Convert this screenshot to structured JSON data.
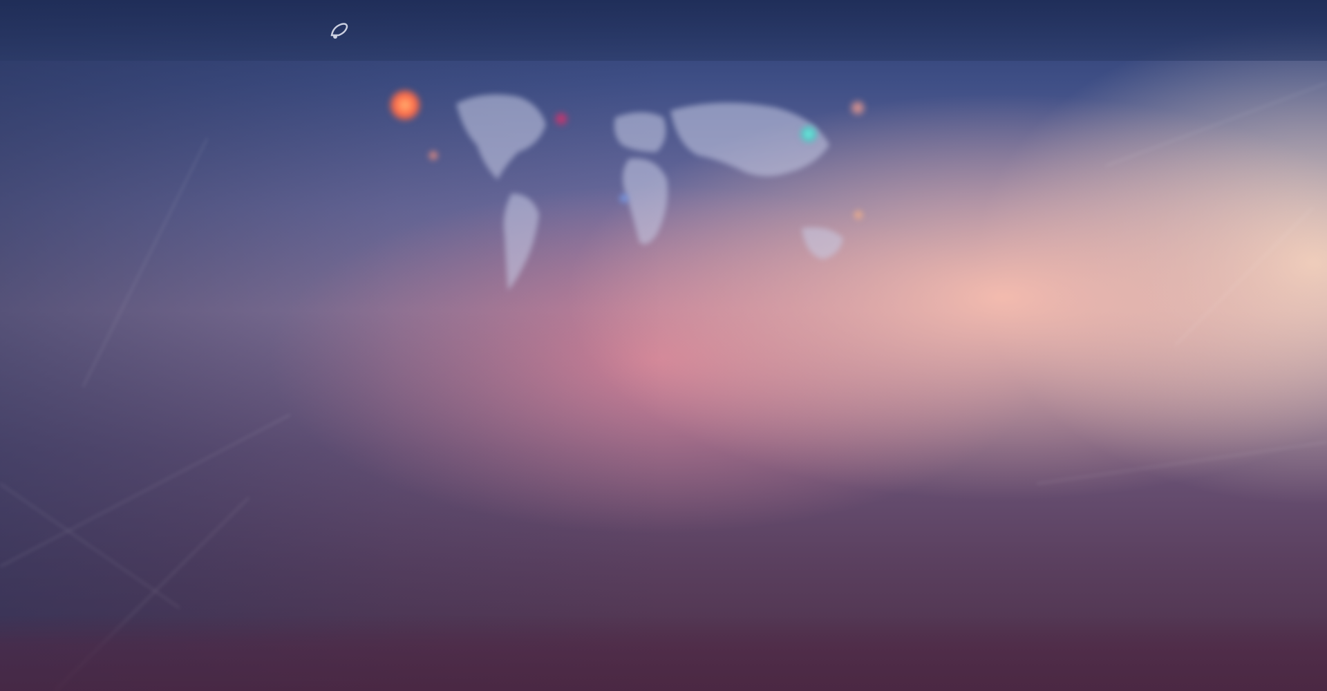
{
  "navbar": {
    "logo_text": "",
    "links": [
      {
        "label": ""
      },
      {
        "label": ""
      },
      {
        "label": ""
      }
    ],
    "auth": {
      "primary": "",
      "secondary": ""
    }
  },
  "hotspots": [
    {
      "color": "#ff7a50"
    },
    {
      "color": "#d0306a"
    },
    {
      "color": "#5fd6d0"
    },
    {
      "color": "#f08878"
    },
    {
      "color": "#6a8ee0"
    },
    {
      "color": "#e88a80"
    },
    {
      "color": "#f0a070"
    }
  ]
}
